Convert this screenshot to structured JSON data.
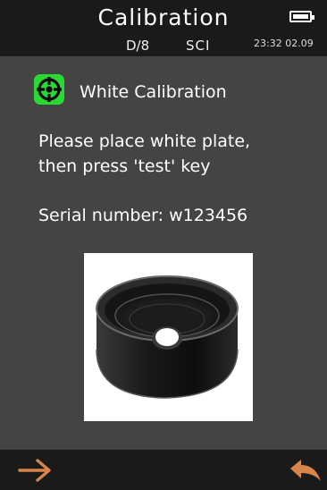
{
  "header": {
    "title": "Calibration",
    "geometry": "D/8",
    "mode": "SCI",
    "clock": "23:32 02.09",
    "battery_icon": "battery-full-icon"
  },
  "content": {
    "icon": "white-calibration-icon",
    "section_title": "White Calibration",
    "instruction": "Please place white plate,\nthen press 'test' key",
    "serial": "Serial number: w123456",
    "image": "white-calibration-plate"
  },
  "footer": {
    "next_icon": "right-arrow-icon",
    "back_icon": "return-arrow-icon"
  },
  "colors": {
    "accent_green": "#2bd934",
    "arrow_orange": "#d9844b",
    "header_bg": "#1a1a1a",
    "body_bg": "#444444"
  }
}
